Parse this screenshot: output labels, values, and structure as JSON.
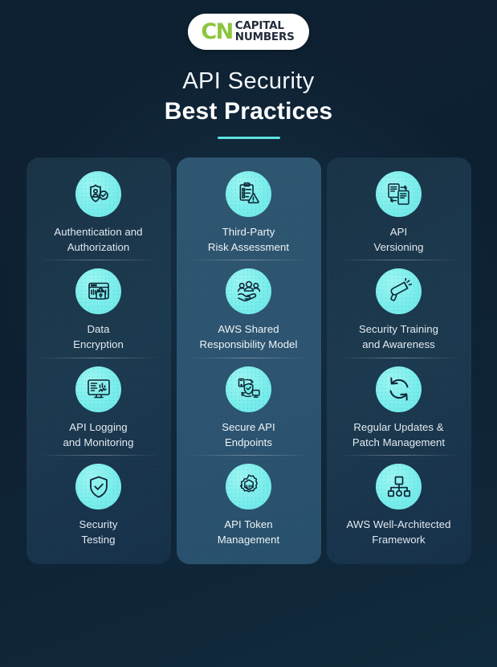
{
  "brand": {
    "logo_mark": "CN",
    "name_line1": "CAPITAL",
    "name_line2": "NUMBERS",
    "mark_color": "#8cc63e",
    "text_color": "#232d3b"
  },
  "heading": {
    "line1": "API Security",
    "line2": "Best Practices",
    "accent_color": "#5de3e0"
  },
  "theme": {
    "background_dark": "#0e2132",
    "panel_dark": "#1c3a4f",
    "panel_mid": "#2d5470",
    "icon_circle": "#77eceb",
    "icon_stroke": "#0f2535",
    "label_color": "#e3eaf0"
  },
  "columns": [
    {
      "id": "column-1",
      "style": "dark",
      "items": [
        {
          "icon": "shield-user-check-icon",
          "label": "Authentication and\nAuthorization"
        },
        {
          "icon": "browser-lock-icon",
          "label": "Data\nEncryption"
        },
        {
          "icon": "monitor-analytics-icon",
          "label": "API Logging\nand Monitoring"
        },
        {
          "icon": "shield-check-icon",
          "label": "Security\nTesting"
        }
      ]
    },
    {
      "id": "column-2",
      "style": "mid",
      "items": [
        {
          "icon": "clipboard-warning-icon",
          "label": "Third-Party\nRisk Assessment"
        },
        {
          "icon": "people-hand-icon",
          "label": "AWS Shared\nResponsibility Model"
        },
        {
          "icon": "devices-shield-sync-icon",
          "label": "Secure API\nEndpoints"
        },
        {
          "icon": "gear-api-icon",
          "label": "API Token\nManagement"
        }
      ]
    },
    {
      "id": "column-3",
      "style": "dark",
      "items": [
        {
          "icon": "documents-sync-icon",
          "label": "API\nVersioning"
        },
        {
          "icon": "megaphone-icon",
          "label": "Security Training\nand Awareness"
        },
        {
          "icon": "refresh-cycle-icon",
          "label": "Regular Updates &\nPatch Management"
        },
        {
          "icon": "sitemap-hierarchy-icon",
          "label": "AWS Well-Architected\nFramework"
        }
      ]
    }
  ]
}
